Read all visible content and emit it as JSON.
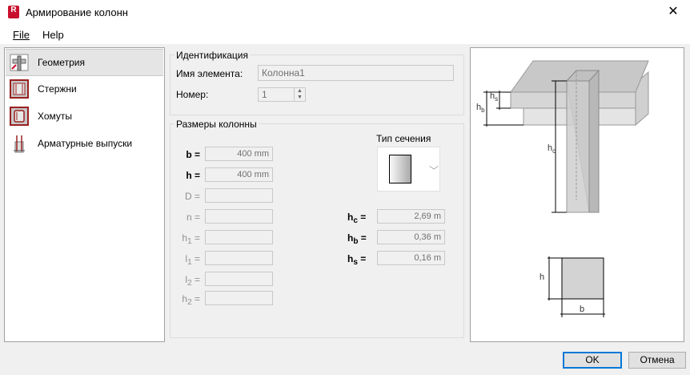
{
  "window": {
    "title": "Армирование колонн",
    "app_icon_letter": "R",
    "close_glyph": "✕"
  },
  "menu": {
    "file": "File",
    "help": "Help"
  },
  "sidebar": {
    "items": [
      {
        "label": "Геометрия",
        "icon": "geometry-icon",
        "selected": true
      },
      {
        "label": "Стержни",
        "icon": "bars-icon",
        "selected": false
      },
      {
        "label": "Хомуты",
        "icon": "stirrups-icon",
        "selected": false
      },
      {
        "label": "Арматурные выпуски",
        "icon": "starter-bars-icon",
        "selected": false
      }
    ]
  },
  "identification": {
    "title": "Идентификация",
    "name_label": "Имя элемента:",
    "name_value": "Колонна1",
    "number_label": "Номер:",
    "number_value": "1"
  },
  "dimensions": {
    "title": "Размеры колонны",
    "section_type_label": "Тип сечения",
    "b": {
      "letter": "b",
      "sub": "",
      "suffix": " =",
      "value": "400 mm"
    },
    "h": {
      "letter": "h",
      "sub": "",
      "suffix": " =",
      "value": "400 mm"
    },
    "D": {
      "letter": "D",
      "sub": "",
      "suffix": " =",
      "value": ""
    },
    "n": {
      "letter": "n",
      "sub": "",
      "suffix": " =",
      "value": ""
    },
    "h1": {
      "letter": "h",
      "sub": "1",
      "suffix": " =",
      "value": ""
    },
    "l1": {
      "letter": "l",
      "sub": "1",
      "suffix": " =",
      "value": ""
    },
    "l2": {
      "letter": "l",
      "sub": "2",
      "suffix": " =",
      "value": ""
    },
    "h2": {
      "letter": "h",
      "sub": "2",
      "suffix": " =",
      "value": ""
    },
    "hc": {
      "letter": "h",
      "sub": "c",
      "suffix": " =",
      "value": "2,69 m"
    },
    "hb": {
      "letter": "h",
      "sub": "b",
      "suffix": " =",
      "value": "0,36 m"
    },
    "hs": {
      "letter": "h",
      "sub": "s",
      "suffix": " =",
      "value": "0,16 m"
    }
  },
  "diagram": {
    "label_hs": {
      "letter": "h",
      "sub": "s"
    },
    "label_hb": {
      "letter": "h",
      "sub": "b"
    },
    "label_hc": {
      "letter": "h",
      "sub": "c"
    },
    "label_h": "h",
    "label_b": "b"
  },
  "buttons": {
    "ok": "OK",
    "cancel": "Отмена"
  },
  "colors": {
    "accent": "#0078d7",
    "brand": "#c8102e"
  }
}
